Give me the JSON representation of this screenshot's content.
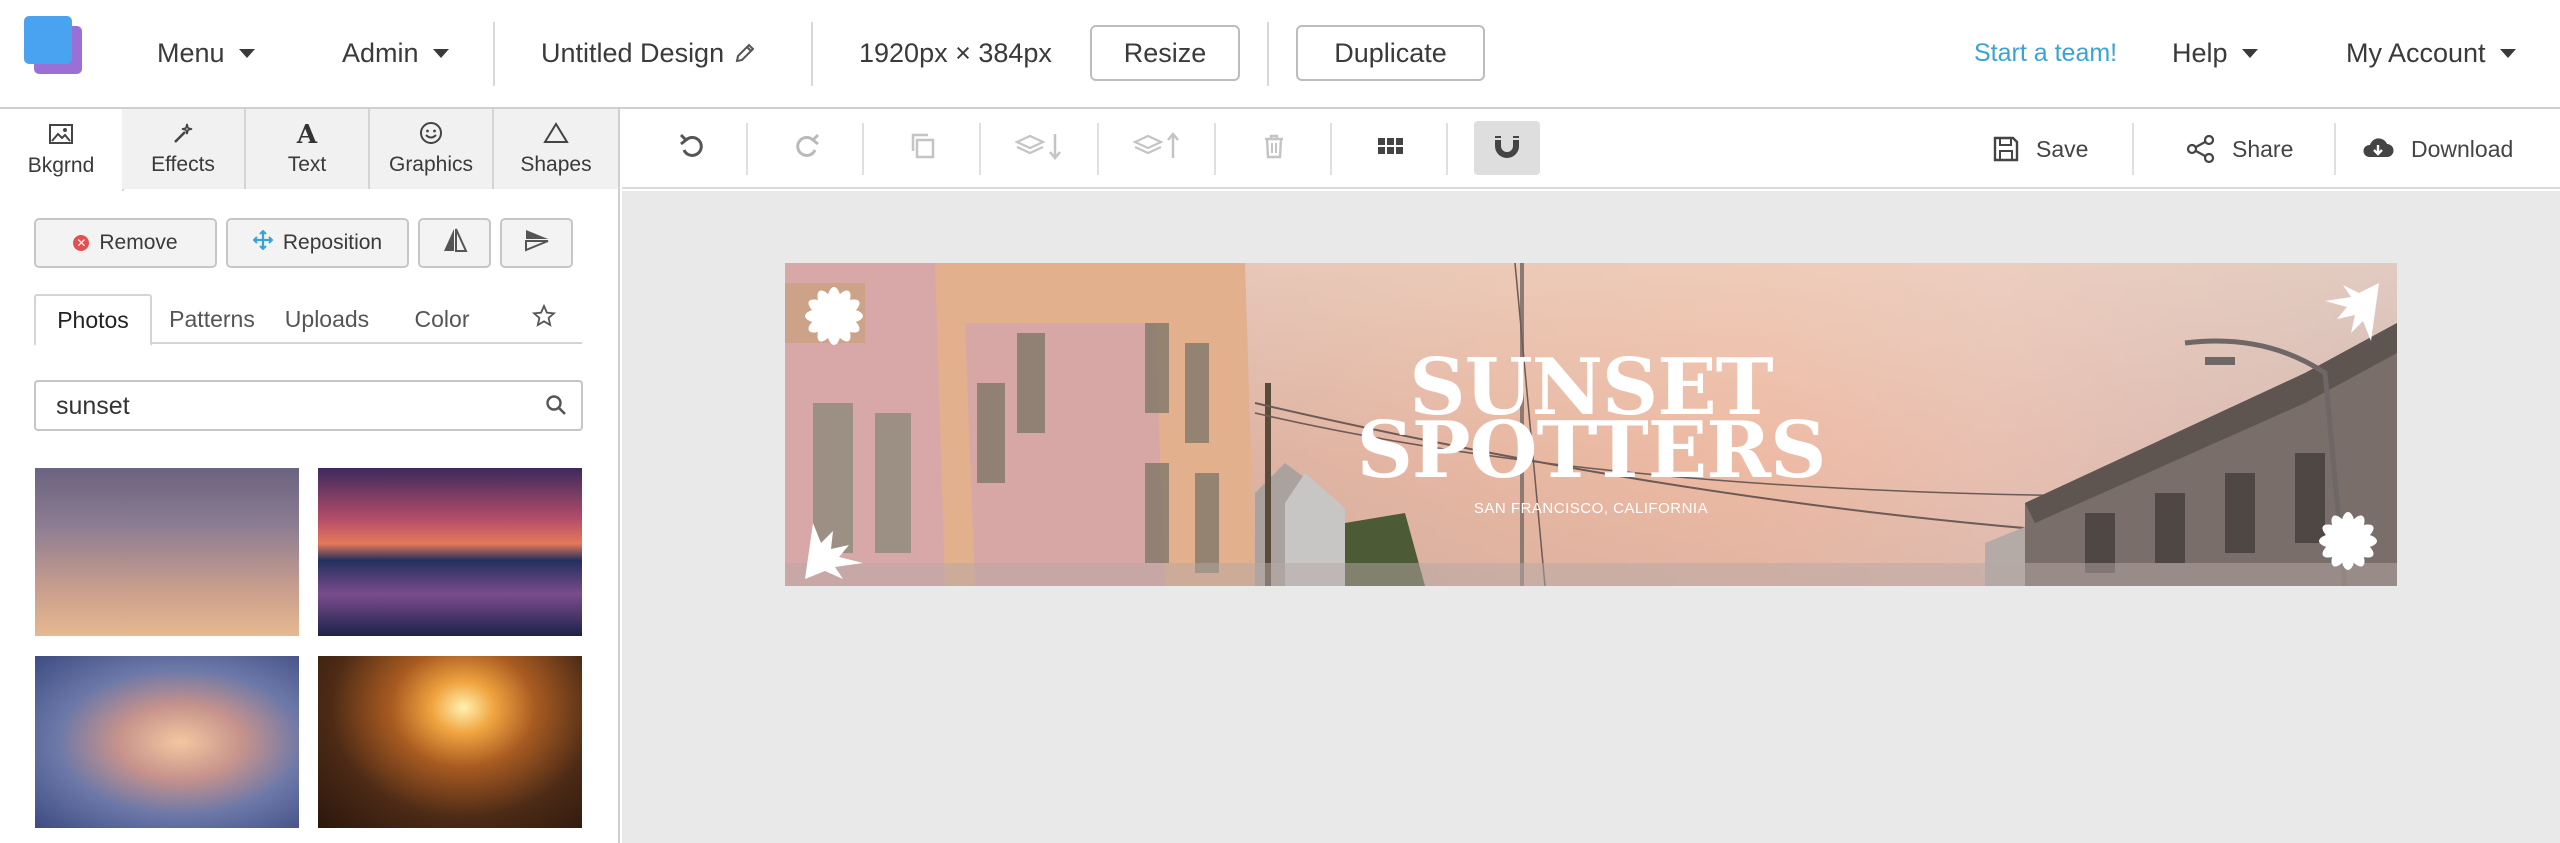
{
  "topbar": {
    "menu_label": "Menu",
    "admin_label": "Admin",
    "design_title": "Untitled Design",
    "dimensions": "1920px × 384px",
    "resize_label": "Resize",
    "duplicate_label": "Duplicate",
    "team_link": "Start a team!",
    "help_label": "Help",
    "account_label": "My Account"
  },
  "panel_tabs": [
    {
      "label": "Bkgrnd",
      "icon": "image-icon"
    },
    {
      "label": "Effects",
      "icon": "wand-icon"
    },
    {
      "label": "Text",
      "icon": "text-icon"
    },
    {
      "label": "Graphics",
      "icon": "smiley-icon"
    },
    {
      "label": "Shapes",
      "icon": "triangle-icon"
    }
  ],
  "bg_tools": {
    "remove_label": "Remove",
    "reposition_label": "Reposition"
  },
  "source_tabs": [
    "Photos",
    "Patterns",
    "Uploads",
    "Color"
  ],
  "search": {
    "value": "sunset",
    "placeholder": ""
  },
  "toolbar": {
    "save_label": "Save",
    "share_label": "Share",
    "download_label": "Download"
  },
  "design": {
    "title_line1": "SUNSET",
    "title_line2": "SPOTTERS",
    "subtitle": "SAN FRANCISCO, CALIFORNIA"
  },
  "colors": {
    "accent": "#3aa3d6",
    "logo_front": "#4aa3f0",
    "logo_back": "#9b6fd6",
    "remove_dot": "#e05151"
  }
}
